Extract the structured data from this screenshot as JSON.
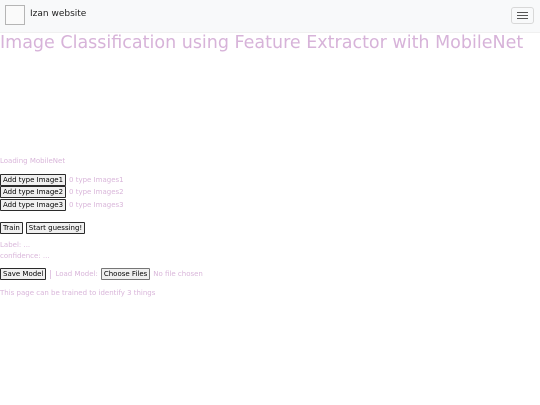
{
  "navbar": {
    "brand_text": "Izan website",
    "logo_icon": "broken-image-icon",
    "menu_icon": "hamburger-icon"
  },
  "page": {
    "title": "Image Classification using Feature Extractor with MobileNet",
    "status": "Loading MobileNet",
    "classes": [
      {
        "button_label": "Add type Image1",
        "count_text": "0 type Images1"
      },
      {
        "button_label": "Add type Image2",
        "count_text": "0 type Images2"
      },
      {
        "button_label": "Add type Image3",
        "count_text": "0 type Images3"
      }
    ],
    "train_label": "Train",
    "guess_label": "Start guessing!",
    "label_text": "Label: ...",
    "confidence_text": "confidence: ...",
    "save_label": "Save Model",
    "load_label": "Load Model:",
    "choose_files_label": "Choose Files",
    "file_status": "No file chosen",
    "footnote": "This page can be trained to identify 3 things"
  },
  "colors": {
    "text_accent": "#d9b6da",
    "navbar_bg": "#f8f9fa"
  }
}
